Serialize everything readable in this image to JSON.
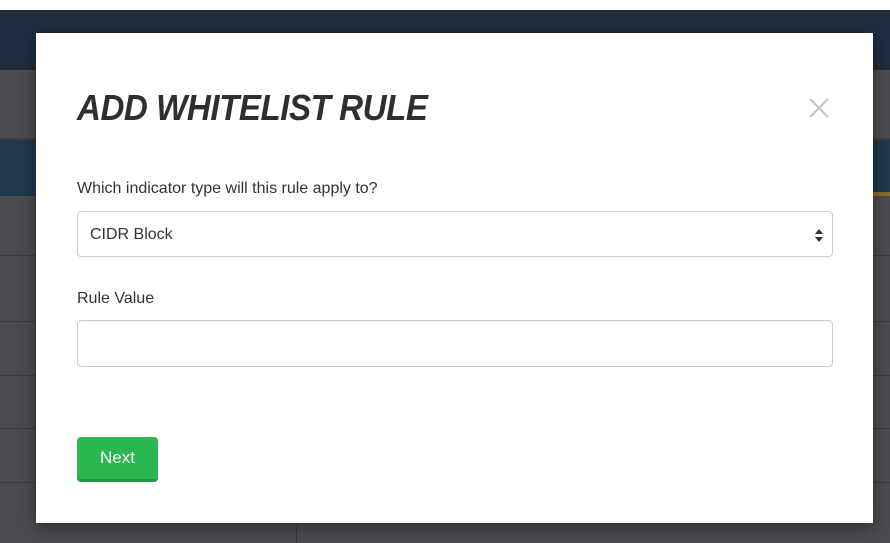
{
  "modal": {
    "title": "ADD WHITELIST RULE",
    "close_icon": "close-icon",
    "indicator_type_label": "Which indicator type will this rule apply to?",
    "indicator_type_selected": "CIDR Block",
    "rule_value_label": "Rule Value",
    "rule_value_value": "",
    "rule_value_placeholder": "",
    "next_label": "Next"
  },
  "colors": {
    "primary_button": "#2bb64f",
    "title_text": "#2f2f2f",
    "backdrop_nav": "#1e2e3f",
    "backdrop_header": "#23384f"
  }
}
